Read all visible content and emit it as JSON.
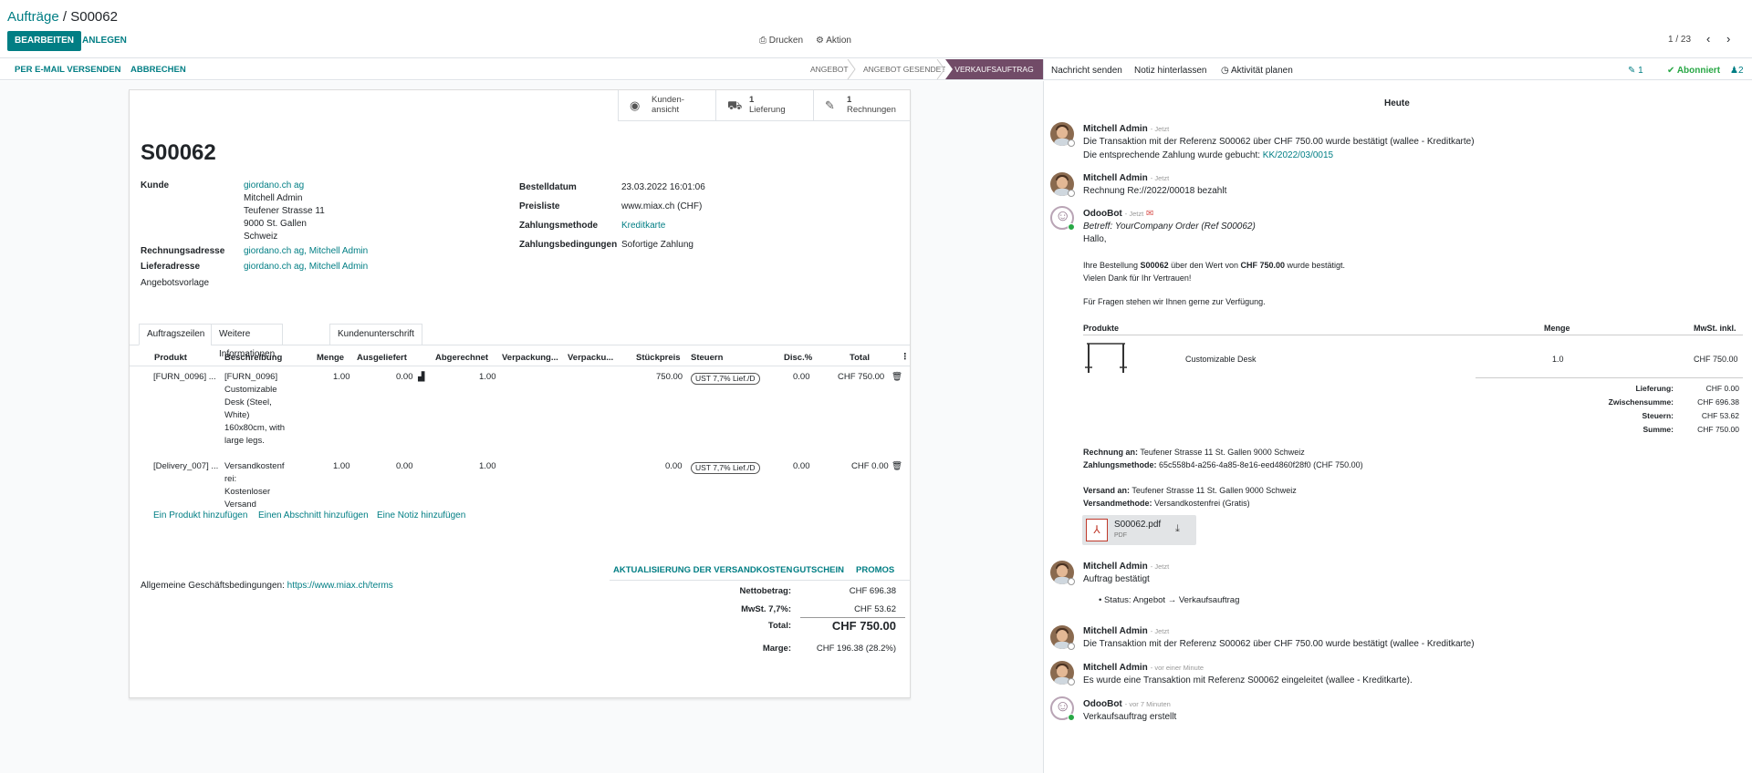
{
  "breadcrumb": {
    "parent": "Aufträge",
    "sep": " / ",
    "current": "S00062"
  },
  "toolbar": {
    "edit": "BEARBEITEN",
    "create": "ANLEGEN",
    "print": "Drucken",
    "action": "Aktion"
  },
  "pager": {
    "value": "1 / 23",
    "prev_icon": "chevron-left-icon",
    "next_icon": "chevron-right-icon"
  },
  "statusbar": {
    "send_email": "PER E-MAIL VERSENDEN",
    "cancel": "ABBRECHEN",
    "stages": [
      "ANGEBOT",
      "ANGEBOT GESENDET",
      "VERKAUFSAUFTRAG"
    ],
    "current_stage": "VERKAUFSAUFTRAG",
    "stage_color": "#714b67"
  },
  "chatter_head": {
    "send_message": "Nachricht senden",
    "log_note": "Notiz hinterlassen",
    "schedule": "Aktivität planen",
    "attachments": "1",
    "follow": "Abonniert",
    "followers": "2"
  },
  "smart_buttons": [
    {
      "icon": "globe-icon",
      "line1": "Kunden-",
      "line2": "ansicht"
    },
    {
      "icon": "truck-icon",
      "line1": "1",
      "line2": "Lieferung"
    },
    {
      "icon": "edit-icon",
      "line1": "1",
      "line2": "Rechnungen"
    }
  ],
  "order": {
    "name": "S00062",
    "customer_label": "Kunde",
    "customer": "giordano.ch ag",
    "customer_addr": [
      "Mitchell Admin",
      "Teufener Strasse 11",
      "9000 St. Gallen",
      "Schweiz"
    ],
    "invoice_label": "Rechnungsadresse",
    "invoice_addr": "giordano.ch ag, Mitchell Admin",
    "delivery_label": "Lieferadresse",
    "delivery_addr": "giordano.ch ag, Mitchell Admin",
    "template_label": "Angebotsvorlage",
    "date_label": "Bestelldatum",
    "date": "23.03.2022 16:01:06",
    "pricelist_label": "Preisliste",
    "pricelist": "www.miax.ch (CHF)",
    "payment_method_label": "Zahlungsmethode",
    "payment_method": "Kreditkarte",
    "payment_terms_label": "Zahlungsbedingungen",
    "payment_terms": "Sofortige Zahlung"
  },
  "tabs": [
    "Auftragszeilen",
    "Weitere Informationen",
    "Kundenunterschrift"
  ],
  "table": {
    "headers": [
      "Produkt",
      "Beschreibung",
      "Menge",
      "Ausgeliefert",
      "Abgerechnet",
      "Verpackung...",
      "Verpacku...",
      "Stückpreis",
      "Steuern",
      "Disc.%",
      "Total"
    ],
    "rows": [
      {
        "product": "[FURN_0096] ...",
        "desc": [
          "[FURN_0096]",
          "Customizable",
          "Desk (Steel,",
          "White)",
          "160x80cm, with",
          "large legs."
        ],
        "qty": "1.00",
        "delivered": "0.00",
        "invoiced": "1.00",
        "price": "750.00",
        "tax": "UST 7,7% Lief./D",
        "disc": "0.00",
        "total": "CHF 750.00"
      },
      {
        "product": "[Delivery_007] ...",
        "desc": [
          "Versandkostenf",
          "rei:",
          "Kostenloser",
          "Versand"
        ],
        "qty": "1.00",
        "delivered": "0.00",
        "invoiced": "1.00",
        "price": "0.00",
        "tax": "UST 7,7% Lief./D",
        "disc": "0.00",
        "total": "CHF 0.00"
      }
    ],
    "add_product": "Ein Produkt hinzufügen",
    "add_section": "Einen Abschnitt hinzufügen",
    "add_note": "Eine Notiz hinzufügen"
  },
  "footer_buttons": [
    "AKTUALISIERUNG DER VERSANDKOSTEN",
    "GUTSCHEIN",
    "PROMOS"
  ],
  "terms": {
    "label": "Allgemeine Geschäftsbedingungen: ",
    "url": "https://www.miax.ch/terms"
  },
  "totals": {
    "net_label": "Nettobetrag:",
    "net": "CHF 696.38",
    "tax_label": "MwSt. 7,7%:",
    "tax": "CHF 53.62",
    "total_label": "Total:",
    "total": "CHF 750.00",
    "margin_label": "Marge:",
    "margin": "CHF 196.38 (28.2%)"
  },
  "chatter": {
    "today": "Heute",
    "messages": [
      {
        "author": "Mitchell Admin",
        "time": "- Jetzt",
        "lines": [
          "Die Transaktion mit der Referenz S00062 über CHF 750.00 wurde bestätigt (wallee - Kreditkarte)"
        ],
        "line2_prefix": "Die entsprechende Zahlung wurde gebucht: ",
        "line2_link": "KK/2022/03/0015"
      },
      {
        "author": "Mitchell Admin",
        "time": "- Jetzt",
        "lines": [
          "Rechnung Re://2022/00018 bezahlt"
        ]
      },
      {
        "author": "OdooBot",
        "time": "- Jetzt",
        "subject_prefix": "Betreff: ",
        "subject": "YourCompany Order (Ref S00062)",
        "greeting": "Hallo,",
        "body1_pre": "Ihre Bestellung ",
        "body1_ref": "S00062",
        "body1_mid": " über den Wert von ",
        "body1_amt": "CHF 750.00",
        "body1_post": " wurde bestätigt.",
        "body2": "Vielen Dank für Ihr Vertrauen!",
        "body3": "Für Fragen stehen wir Ihnen gerne zur Verfügung.",
        "table_headers": [
          "Produkte",
          "Menge",
          "MwSt. inkl."
        ],
        "table_product": "Customizable Desk",
        "table_qty": "1.0",
        "table_amount": "CHF 750.00",
        "sum_rows": [
          [
            "Lieferung:",
            "CHF 0.00"
          ],
          [
            "Zwischensumme:",
            "CHF 696.38"
          ],
          [
            "Steuern:",
            "CHF 53.62"
          ],
          [
            "Summe:",
            "CHF 750.00"
          ]
        ],
        "invoice_to_label": "Rechnung an:",
        "invoice_to": " Teufener Strasse 11 St. Gallen 9000 Schweiz",
        "payment_label": "Zahlungsmethode:",
        "payment": " 65c558b4-a256-4a85-8e16-eed4860f28f0 (CHF 750.00)",
        "ship_to_label": "Versand an:",
        "ship_to": " Teufener Strasse 11 St. Gallen 9000 Schweiz",
        "ship_method_label": "Versandmethode:",
        "ship_method": " Versandkostenfrei (Gratis)",
        "attachment": "S00062.pdf",
        "attachment_type": "PDF"
      },
      {
        "author": "Mitchell Admin",
        "time": "- Jetzt",
        "lines": [
          "Auftrag bestätigt"
        ],
        "bullet": "Status: Angebot → Verkaufsauftrag"
      },
      {
        "author": "Mitchell Admin",
        "time": "- Jetzt",
        "lines": [
          "Die Transaktion mit der Referenz S00062 über CHF 750.00 wurde bestätigt (wallee - Kreditkarte)"
        ]
      },
      {
        "author": "Mitchell Admin",
        "time": "- vor einer Minute",
        "lines": [
          "Es wurde eine Transaktion mit Referenz S00062 eingeleitet (wallee - Kreditkarte)."
        ]
      },
      {
        "author": "OdooBot",
        "time": "- vor 7 Minuten",
        "lines": [
          "Verkaufsauftrag erstellt"
        ]
      }
    ]
  }
}
